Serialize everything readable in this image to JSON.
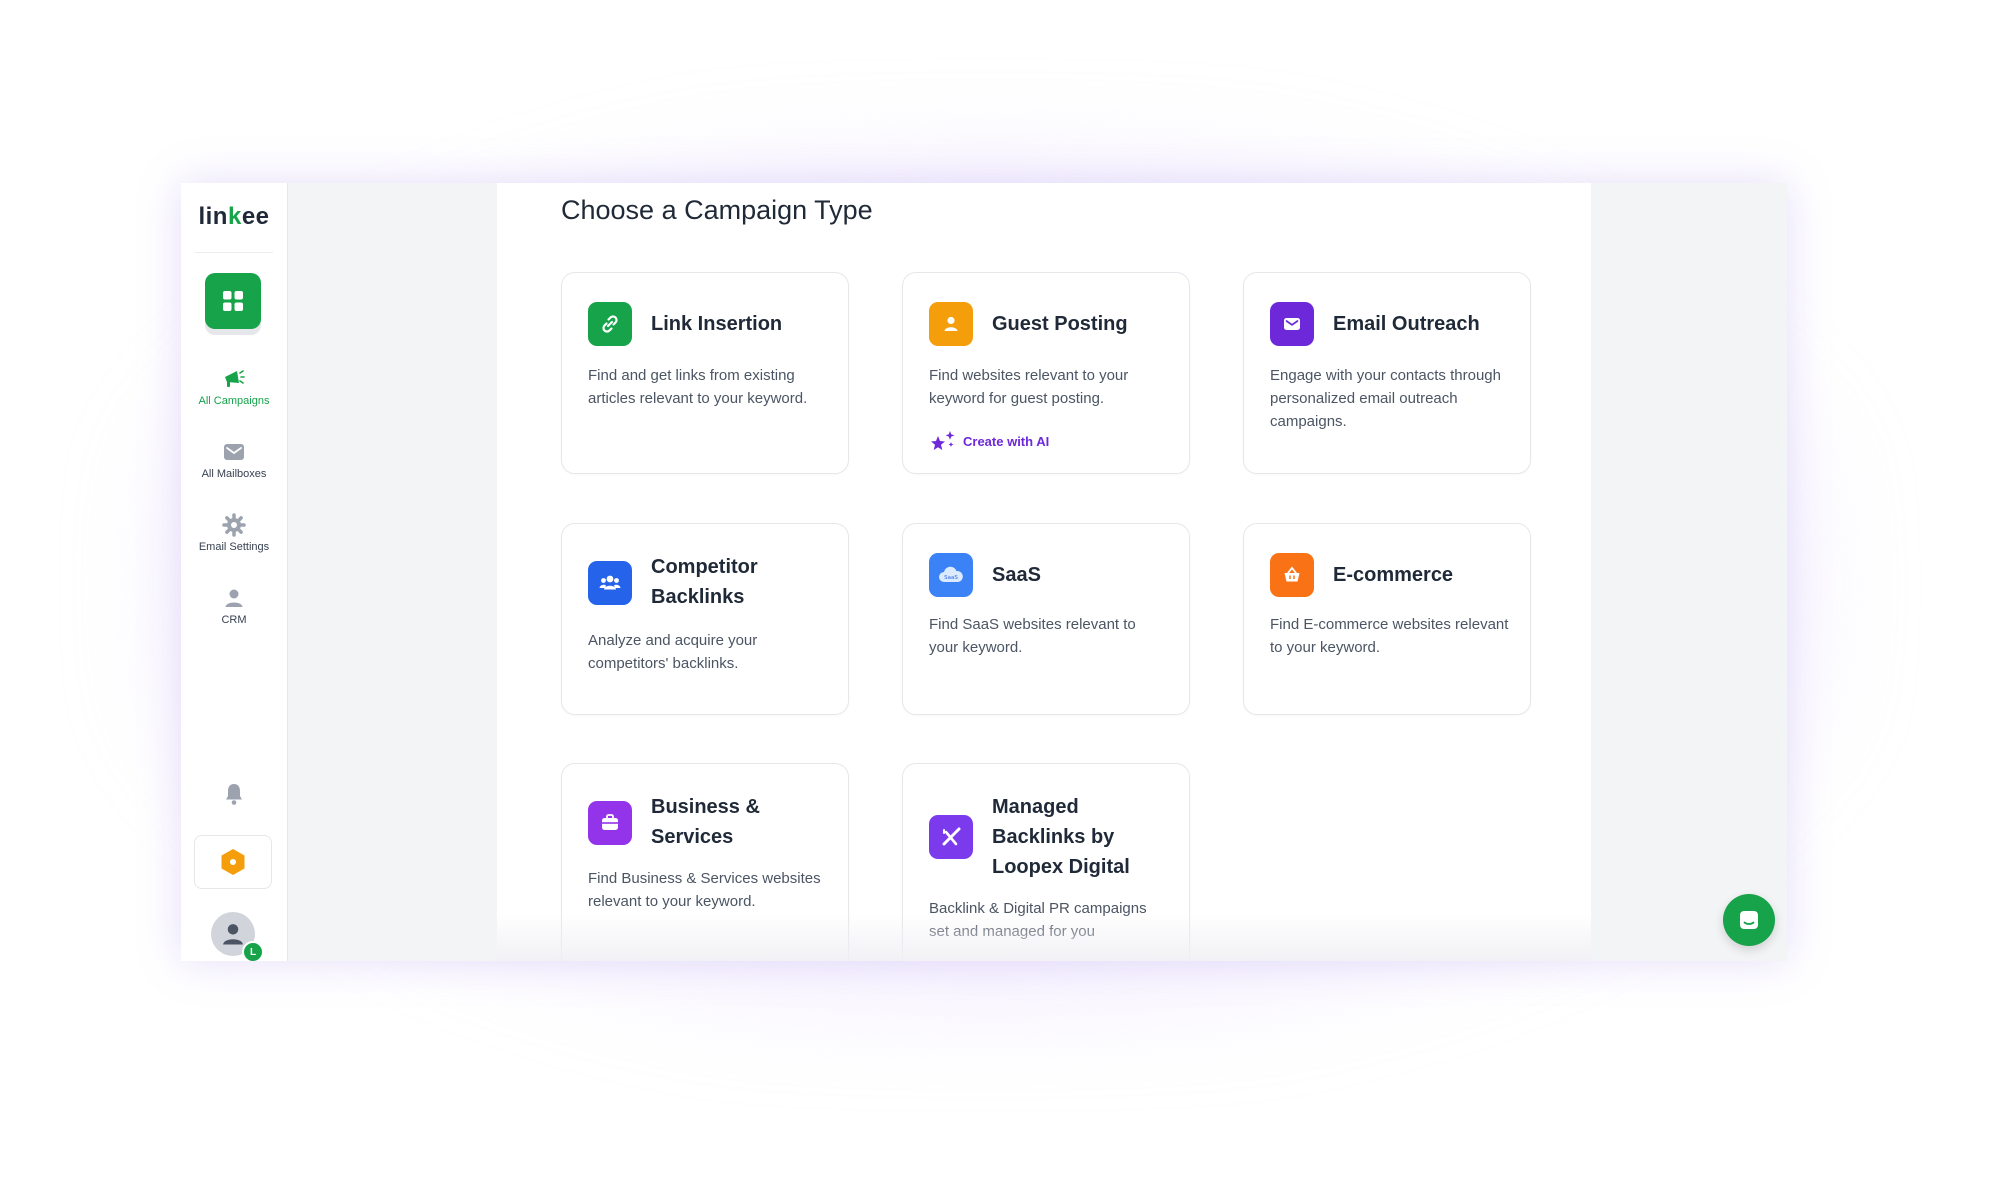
{
  "app": {
    "logo_text_left": "lin",
    "logo_text_mark": "k",
    "logo_text_right": "ee"
  },
  "sidebar": {
    "items": [
      {
        "label": "All Campaigns",
        "icon": "megaphone-icon",
        "active": true
      },
      {
        "label": "All Mailboxes",
        "icon": "mail-icon",
        "active": false
      },
      {
        "label": "Email Settings",
        "icon": "gear-icon",
        "active": false
      },
      {
        "label": "CRM",
        "icon": "user-icon",
        "active": false
      }
    ],
    "avatar_badge": "L"
  },
  "main": {
    "title": "Choose a Campaign Type",
    "cards": [
      {
        "title": "Link Insertion",
        "description": "Find and get links from existing articles relevant to your keyword.",
        "icon": "link-icon",
        "color": "#16a34a"
      },
      {
        "title": "Guest Posting",
        "description": "Find websites relevant to your keyword for guest posting.",
        "icon": "person-icon",
        "color": "#f59e0b",
        "ai_label": "Create with AI"
      },
      {
        "title": "Email Outreach",
        "description": "Engage with your contacts through personalized email outreach campaigns.",
        "icon": "envelope-icon",
        "color": "#6d28d9"
      },
      {
        "title": "Competitor Backlinks",
        "description": "Analyze and acquire your competitors' backlinks.",
        "icon": "group-icon",
        "color": "#2563eb"
      },
      {
        "title": "SaaS",
        "description": "Find SaaS websites relevant to your keyword.",
        "icon": "cloud-icon",
        "color": "#3b82f6"
      },
      {
        "title": "E-commerce",
        "description": "Find E-commerce websites relevant to your keyword.",
        "icon": "basket-icon",
        "color": "#f97316"
      },
      {
        "title": "Business & Services",
        "description": "Find Business & Services websites relevant to your keyword.",
        "icon": "briefcase-icon",
        "color": "#9333ea"
      },
      {
        "title": "Managed Backlinks by Loopex Digital",
        "description": "Backlink & Digital PR campaigns set and managed for you",
        "icon": "loopex-icon",
        "color": "#7c3aed"
      }
    ]
  },
  "colors": {
    "accent": "#16a34a",
    "ai": "#6d28d9"
  }
}
